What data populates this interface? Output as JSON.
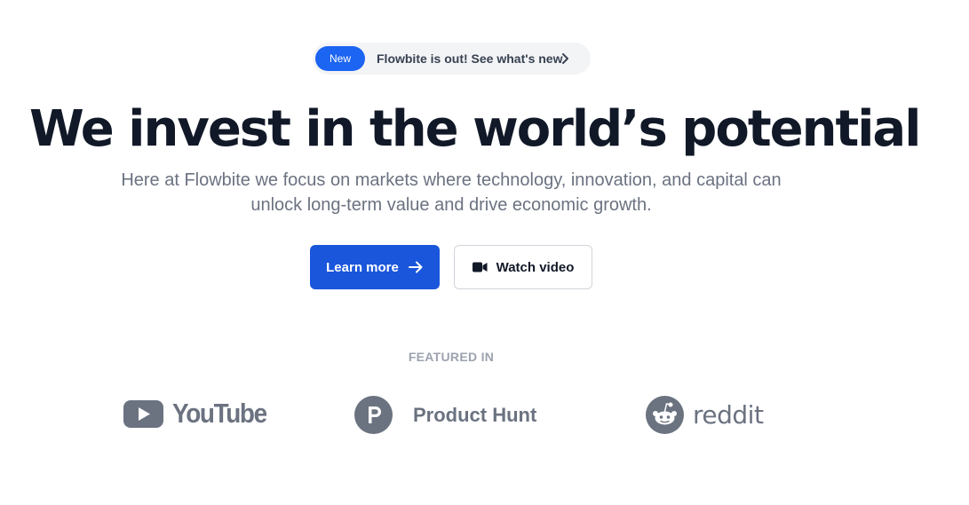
{
  "announcement": {
    "badge": "New",
    "message": "Flowbite is out! See what's new"
  },
  "hero": {
    "title": "We invest in the world’s potential",
    "subtitle": "Here at Flowbite we focus on markets where technology, innovation, and capital can unlock long-term value and drive economic growth."
  },
  "actions": {
    "primary_label": "Learn more",
    "secondary_label": "Watch video"
  },
  "featured": {
    "heading": "FEATURED IN",
    "logos": [
      {
        "name": "YouTube",
        "icon": "youtube-icon"
      },
      {
        "name": "Product Hunt",
        "icon": "product-hunt-icon"
      },
      {
        "name": "reddit",
        "icon": "reddit-icon"
      }
    ]
  },
  "colors": {
    "brand": "#1a56db",
    "heading": "#111827",
    "muted": "#6b7280",
    "logo_gray": "#6b7280"
  }
}
